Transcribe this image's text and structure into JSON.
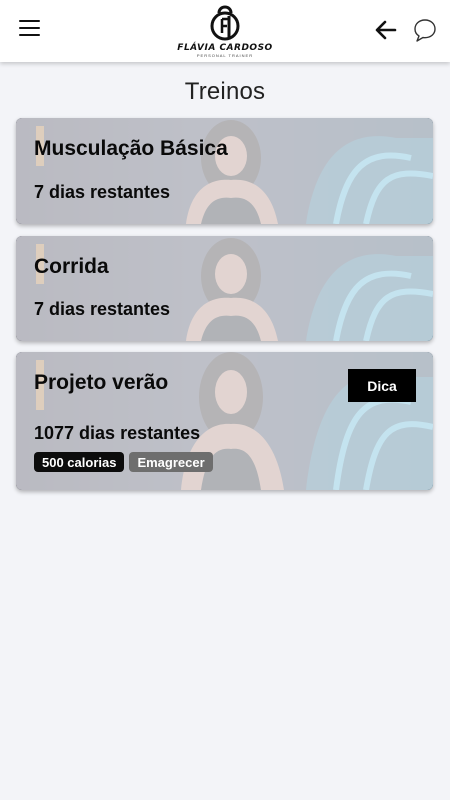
{
  "header": {
    "logo_name": "FLÁVIA CARDOSO",
    "logo_subtitle": "PERSONAL TRAINER",
    "menu_icon": "hamburger-icon",
    "back_icon": "arrow-left-icon",
    "chat_icon": "chat-bubble-icon"
  },
  "page": {
    "title": "Treinos"
  },
  "workouts": [
    {
      "title": "Musculação Básica",
      "days": "7 dias restantes"
    },
    {
      "title": "Corrida",
      "days": "7 dias restantes"
    },
    {
      "title": "Projeto verão",
      "days": "1077 dias restantes",
      "tip_label": "Dica",
      "tags": [
        "500 calorias",
        "Emagrecer"
      ]
    }
  ],
  "colors": {
    "background": "#f3f4f8",
    "header": "#ffffff",
    "tag_dark": "#0c0c0c",
    "tag_gray": "#6e6e6e",
    "tip_button": "#000000"
  }
}
